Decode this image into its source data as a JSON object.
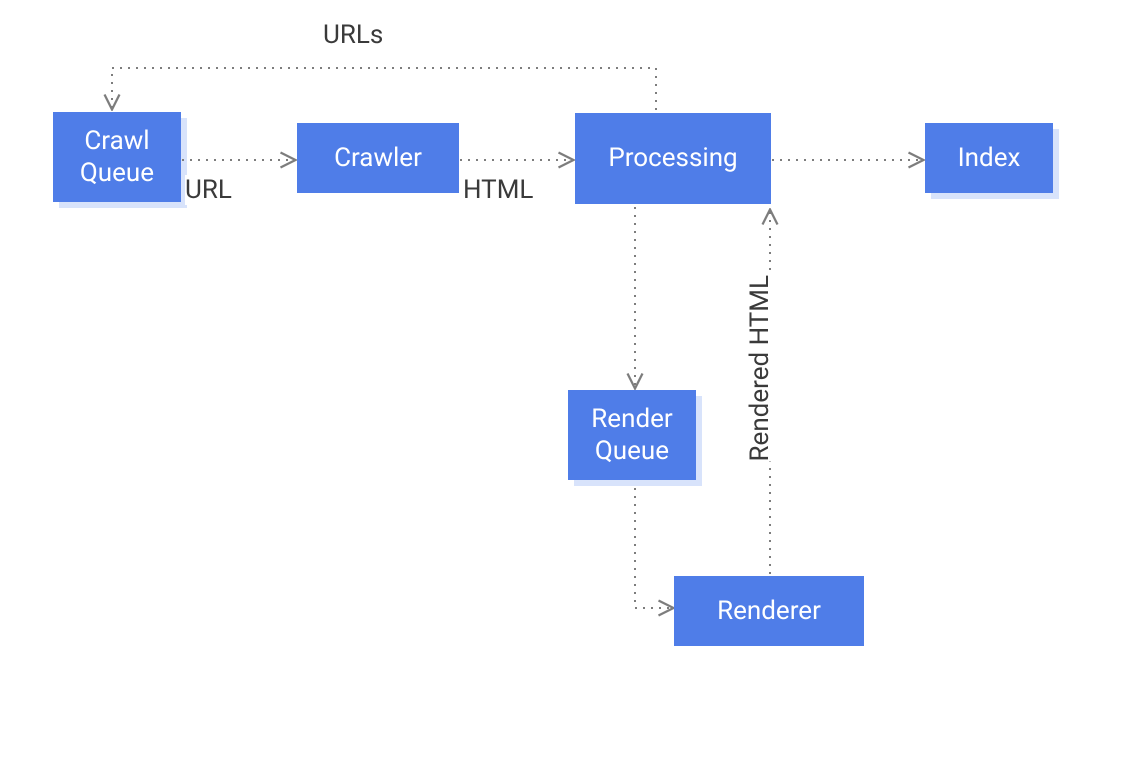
{
  "diagram": {
    "nodes": {
      "crawl_queue": "Crawl\nQueue",
      "crawler": "Crawler",
      "processing": "Processing",
      "index": "Index",
      "render_queue": "Render\nQueue",
      "renderer": "Renderer"
    },
    "edges": {
      "urls": "URLs",
      "url": "URL",
      "html": "HTML",
      "rendered_html": "Rendered HTML"
    }
  }
}
